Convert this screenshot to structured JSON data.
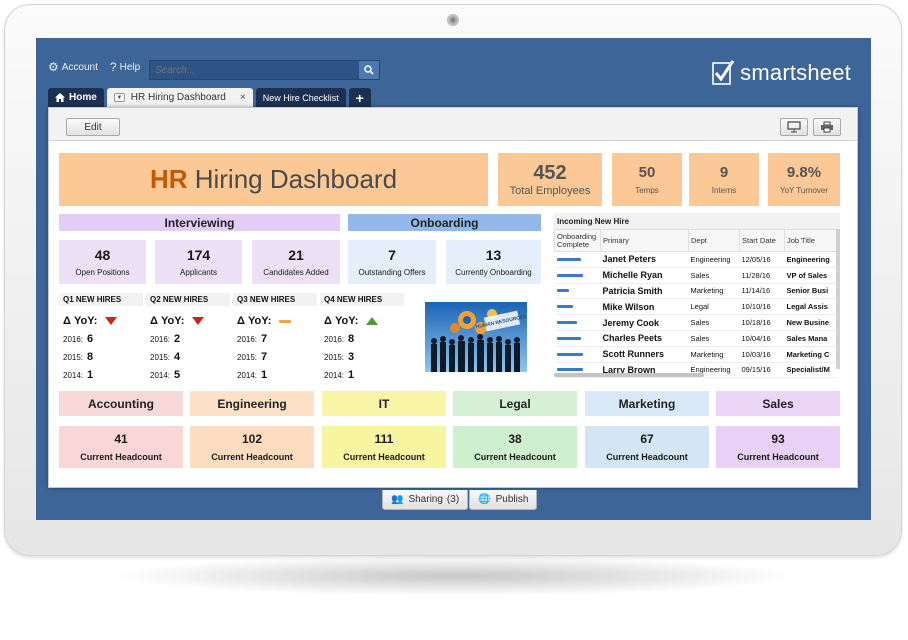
{
  "topbar": {
    "account_label": "Account",
    "help_label": "Help",
    "search_placeholder": "Search..."
  },
  "brand": {
    "name": "smartsheet"
  },
  "tabs": {
    "home": "Home",
    "dashboard": "HR Hiring Dashboard",
    "checklist": "New Hire Checklist",
    "close": "×",
    "add": "+"
  },
  "toolbar": {
    "edit_label": "Edit"
  },
  "header": {
    "title_hr": "HR",
    "title_rest": " Hiring Dashboard"
  },
  "kpis": [
    {
      "value": "452",
      "label": "Total Employees"
    },
    {
      "value": "50",
      "label": "Temps"
    },
    {
      "value": "9",
      "label": "Interns"
    },
    {
      "value": "9.8%",
      "label": "YoY Turnover"
    }
  ],
  "interviewing": {
    "title": "Interviewing",
    "stats": [
      {
        "value": "48",
        "label": "Open Positions"
      },
      {
        "value": "174",
        "label": "Applicants"
      },
      {
        "value": "21",
        "label": "Candidates Added"
      }
    ]
  },
  "onboarding": {
    "title": "Onboarding",
    "stats": [
      {
        "value": "7",
        "label": "Outstanding Offers"
      },
      {
        "value": "13",
        "label": "Currently Onboarding"
      }
    ]
  },
  "quarters": [
    {
      "title": "Q1 NEW HIRES",
      "yoy_label": "Δ YoY:",
      "trend": "down",
      "rows": [
        {
          "year": "2016:",
          "value": "6"
        },
        {
          "year": "2015:",
          "value": "8"
        },
        {
          "year": "2014:",
          "value": "1"
        }
      ]
    },
    {
      "title": "Q2 NEW HIRES",
      "yoy_label": "Δ YoY:",
      "trend": "down",
      "rows": [
        {
          "year": "2016:",
          "value": "2"
        },
        {
          "year": "2015:",
          "value": "4"
        },
        {
          "year": "2014:",
          "value": "5"
        }
      ]
    },
    {
      "title": "Q3 NEW HIRES",
      "yoy_label": "Δ YoY:",
      "trend": "flat",
      "rows": [
        {
          "year": "2016:",
          "value": "7"
        },
        {
          "year": "2015:",
          "value": "7"
        },
        {
          "year": "2014:",
          "value": "1"
        }
      ]
    },
    {
      "title": "Q4 NEW HIRES",
      "yoy_label": "Δ YoY:",
      "trend": "up",
      "rows": [
        {
          "year": "2016:",
          "value": "8"
        },
        {
          "year": "2015:",
          "value": "3"
        },
        {
          "year": "2014:",
          "value": "1"
        }
      ]
    }
  ],
  "image": {
    "caption": "HUMAN RESOURCES"
  },
  "incoming": {
    "title": "Incoming New Hire",
    "columns": [
      "Onboarding Complete",
      "Primary",
      "Dept",
      "Start Date",
      "Job Title"
    ],
    "rows": [
      {
        "progress": 0.6,
        "primary": "Janet Peters",
        "dept": "Engineering",
        "start": "12/05/16",
        "job": "Engineering"
      },
      {
        "progress": 0.65,
        "primary": "Michelle Ryan",
        "dept": "Sales",
        "start": "11/28/16",
        "job": "VP of Sales"
      },
      {
        "progress": 0.3,
        "primary": "Patricia Smith",
        "dept": "Marketing",
        "start": "11/14/16",
        "job": "Senior Busi"
      },
      {
        "progress": 0.4,
        "primary": "Mike Wilson",
        "dept": "Legal",
        "start": "10/10/16",
        "job": "Legal Assis"
      },
      {
        "progress": 0.5,
        "primary": "Jeremy Cook",
        "dept": "Sales",
        "start": "10/18/16",
        "job": "New Busine"
      },
      {
        "progress": 0.6,
        "primary": "Charles Peets",
        "dept": "Sales",
        "start": "10/04/16",
        "job": "Sales Mana"
      },
      {
        "progress": 0.65,
        "primary": "Scott Runners",
        "dept": "Marketing",
        "start": "10/03/16",
        "job": "Marketing C"
      },
      {
        "progress": 0.65,
        "primary": "Larry Brown",
        "dept": "Engineering",
        "start": "09/15/16",
        "job": "Specialist/M"
      }
    ]
  },
  "departments": [
    {
      "name": "Accounting",
      "value": "41",
      "label": "Current Headcount",
      "head_color": "#f7d9d9",
      "body_color": "#fbd6d6"
    },
    {
      "name": "Engineering",
      "value": "102",
      "label": "Current Headcount",
      "head_color": "#fde2c8",
      "body_color": "#fddcbf"
    },
    {
      "name": "IT",
      "value": "111",
      "label": "Current Headcount",
      "head_color": "#f8f5a6",
      "body_color": "#f8f5a0"
    },
    {
      "name": "Legal",
      "value": "38",
      "label": "Current Headcount",
      "head_color": "#d6f0d5",
      "body_color": "#cff0cf"
    },
    {
      "name": "Marketing",
      "value": "67",
      "label": "Current Headcount",
      "head_color": "#d9e9f7",
      "body_color": "#d3e6f6"
    },
    {
      "name": "Sales",
      "value": "93",
      "label": "Current Headcount",
      "head_color": "#ecd6f7",
      "body_color": "#e8d1f6"
    }
  ],
  "footer": {
    "sharing_label": "Sharing",
    "sharing_count": "(3)",
    "publish_label": "Publish"
  },
  "colors": {
    "screen_bg": "#3e6597",
    "hr_accent": "#c45a00",
    "header_tile": "#fbc896",
    "interviewing": "#e3cdf7",
    "onboarding": "#93b9ea",
    "down": "#d0231f",
    "up": "#4f9b3a",
    "flat": "#e7a93b"
  }
}
